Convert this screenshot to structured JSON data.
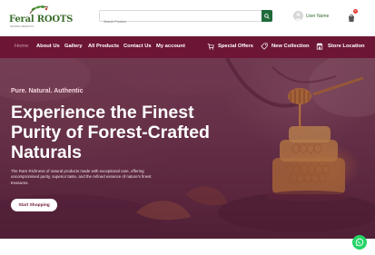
{
  "logo": {
    "text": "Feral ROOTS",
    "tagline": "NATURAL PRODUCTS"
  },
  "search": {
    "placeholder": "Search Product"
  },
  "user": {
    "name": "User Name"
  },
  "cart": {
    "count": "0"
  },
  "nav": {
    "home": "Home",
    "about": "About Us",
    "gallery": "Gallery",
    "products": "All Products",
    "contact": "Contact Us",
    "account": "My account",
    "offers": "Special Offers",
    "collection": "New Collection",
    "store": "Store Location"
  },
  "hero": {
    "tagline": "Pure. Natural. Authentic",
    "headline": "Experience the Finest Purity of Forest-Crafted Naturals",
    "description": "The Rare Richness of natural products made with exceptional care, offering uncompromised purity, superior taste, and the refined essence of nature's finest treasures.",
    "cta": "Start Shopping"
  },
  "colors": {
    "brand": "#6d1534",
    "green": "#1f6b3a",
    "whatsapp": "#25d366"
  },
  "icons": [
    "search-icon",
    "user-icon",
    "cart-icon",
    "offer-icon",
    "tag-icon",
    "store-icon",
    "whatsapp-icon"
  ]
}
